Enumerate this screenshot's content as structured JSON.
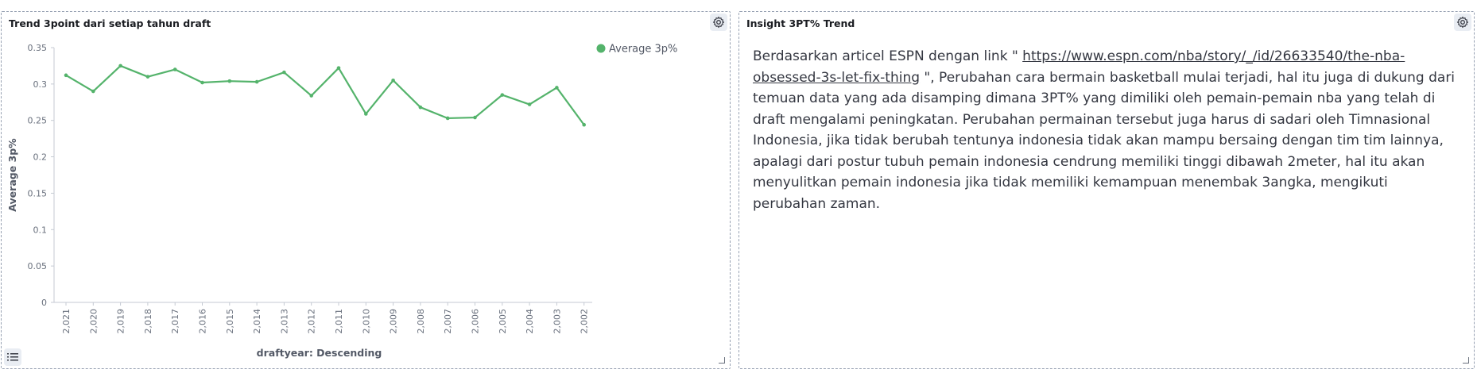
{
  "left_panel": {
    "title": "Trend 3point dari setiap tahun draft"
  },
  "right_panel": {
    "title": "Insight 3PT% Trend",
    "text_before_link": "Berdasarkan articel ESPN dengan link \" ",
    "link_text": "https://www.espn.com/nba/story/_/id/26633540/the-nba-obsessed-3s-let-fix-thing",
    "text_after_link": " \", Perubahan cara bermain basketball mulai terjadi, hal itu juga di dukung dari temuan data yang ada disamping dimana 3PT% yang dimiliki oleh pemain-pemain nba yang telah di draft mengalami peningkatan. Perubahan permainan tersebut juga harus di sadari oleh Timnasional Indonesia, jika tidak berubah tentunya indonesia tidak akan mampu bersaing dengan tim tim lainnya, apalagi dari postur tubuh pemain indonesia cendrung memiliki tinggi dibawah 2meter, hal itu akan menyulitkan pemain indonesia jika tidak memiliki kemampuan menembak 3angka, mengikuti perubahan zaman."
  },
  "icons": {
    "gear": "gear-icon",
    "legend_toggle": "list-icon"
  },
  "chart_data": {
    "type": "line",
    "xlabel": "draftyear: Descending",
    "ylabel": "Average 3p%",
    "categories": [
      "2,021",
      "2,020",
      "2,019",
      "2,018",
      "2,017",
      "2,016",
      "2,015",
      "2,014",
      "2,013",
      "2,012",
      "2,011",
      "2,010",
      "2,009",
      "2,008",
      "2,007",
      "2,006",
      "2,005",
      "2,004",
      "2,003",
      "2,002"
    ],
    "series": [
      {
        "name": "Average 3p%",
        "color": "#54b36b",
        "values": [
          0.312,
          0.29,
          0.325,
          0.31,
          0.32,
          0.302,
          0.304,
          0.303,
          0.316,
          0.284,
          0.322,
          0.259,
          0.305,
          0.268,
          0.253,
          0.254,
          0.285,
          0.272,
          0.295,
          0.244
        ]
      }
    ],
    "yticks": [
      "0",
      "0.05",
      "0.1",
      "0.15",
      "0.2",
      "0.25",
      "0.3",
      "0.35"
    ],
    "ylim": [
      0,
      0.35
    ],
    "legend_position": "top-right",
    "grid": false
  }
}
